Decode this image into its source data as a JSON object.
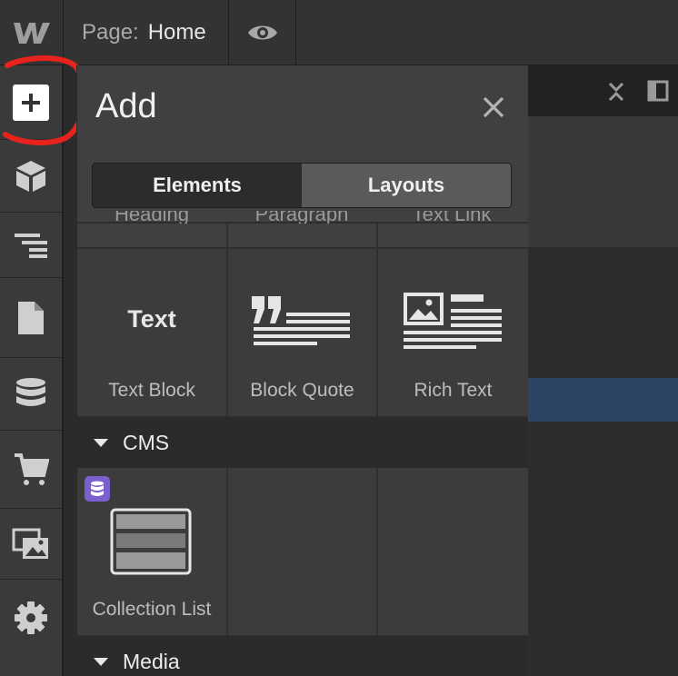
{
  "topbar": {
    "page_label": "Page:",
    "page_value": "Home"
  },
  "panel": {
    "title": "Add",
    "tabs": [
      {
        "label": "Elements",
        "active": true
      },
      {
        "label": "Layouts",
        "active": false
      }
    ],
    "partial_row": [
      "Heading",
      "Paragraph",
      "Text Link"
    ],
    "typography": [
      {
        "preview": "Text",
        "label": "Text Block"
      },
      {
        "preview": "",
        "label": "Block Quote"
      },
      {
        "preview": "",
        "label": "Rich Text"
      }
    ],
    "sections": {
      "cms": "CMS",
      "media": "Media"
    },
    "cms_items": [
      {
        "label": "Collection List"
      }
    ]
  },
  "colors": {
    "accent_red": "#e8231d",
    "cms_badge": "#7b5fcf",
    "selection": "#2d4564"
  }
}
